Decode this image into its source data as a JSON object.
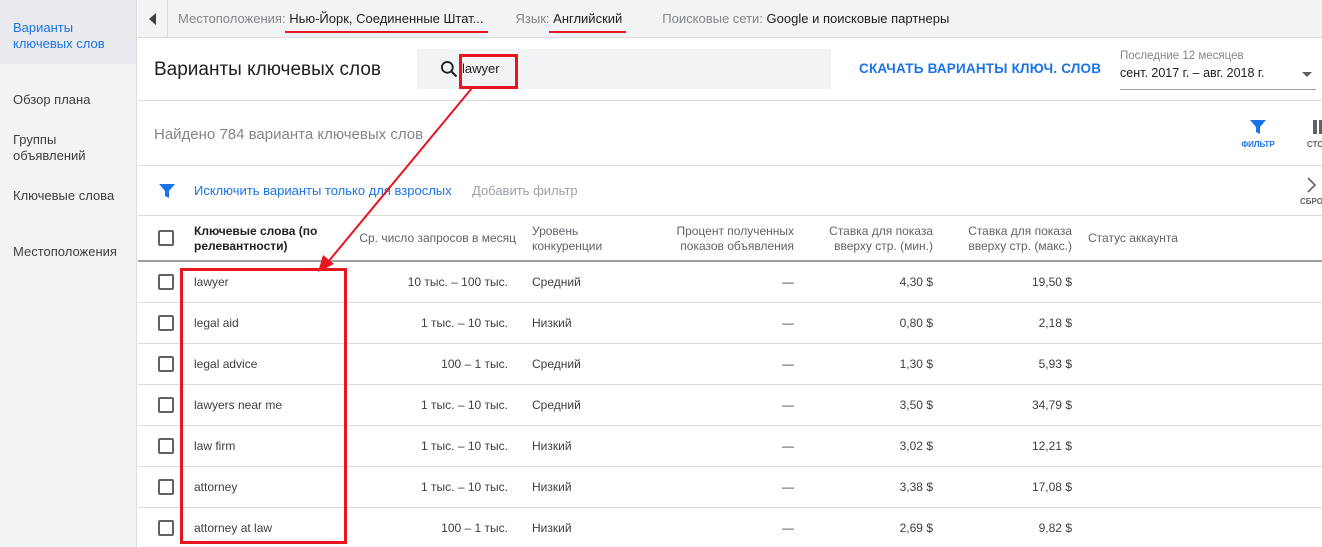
{
  "sidebar": {
    "items": [
      {
        "label": "Варианты ключевых слов",
        "active": true
      },
      {
        "label": "Обзор плана"
      },
      {
        "label": "Группы объявлений"
      },
      {
        "label": "Ключевые слова"
      },
      {
        "label": "Местоположения"
      }
    ]
  },
  "topbar": {
    "location_label": "Местоположения:",
    "location_value": "Нью-Йорк, Соединенные Штат...",
    "language_label": "Язык:",
    "language_value": "Английский",
    "networks_label": "Поисковые сети:",
    "networks_value": "Google и поисковые партнеры"
  },
  "header": {
    "title": "Варианты ключевых слов",
    "search_value": "lawyer",
    "download_label": "СКАЧАТЬ ВАРИАНТЫ КЛЮЧ. СЛОВ",
    "date_label": "Последние 12 месяцев",
    "date_value": "сент. 2017 г. – авг. 2018 г."
  },
  "found": {
    "text": "Найдено 784 варианта ключевых слов",
    "filter_label": "ФИЛЬТР",
    "columns_label": "СТОЛ"
  },
  "filters": {
    "exclude_label": "Исключить варианты только для взрослых",
    "add_filter_label": "Добавить фильтр",
    "reset_label": "СБРО"
  },
  "table": {
    "headers": {
      "keyword": "Ключевые слова (по релевантности)",
      "avg": "Ср. число запросов в месяц",
      "competition": "Уровень конкуренции",
      "share": "Процент полученных показов объявления",
      "bid_low": "Ставка для показа вверху стр. (мин.)",
      "bid_high": "Ставка для показа вверху стр. (макс.)",
      "status": "Статус аккаунта"
    },
    "rows": [
      {
        "keyword": "lawyer",
        "avg": "10 тыс. – 100 тыс.",
        "competition": "Средний",
        "share": "—",
        "bid_low": "4,30 $",
        "bid_high": "19,50 $"
      },
      {
        "keyword": "legal aid",
        "avg": "1 тыс. – 10 тыс.",
        "competition": "Низкий",
        "share": "—",
        "bid_low": "0,80 $",
        "bid_high": "2,18 $"
      },
      {
        "keyword": "legal advice",
        "avg": "100 – 1 тыс.",
        "competition": "Средний",
        "share": "—",
        "bid_low": "1,30 $",
        "bid_high": "5,93 $"
      },
      {
        "keyword": "lawyers near me",
        "avg": "1 тыс. – 10 тыс.",
        "competition": "Средний",
        "share": "—",
        "bid_low": "3,50 $",
        "bid_high": "34,79 $"
      },
      {
        "keyword": "law firm",
        "avg": "1 тыс. – 10 тыс.",
        "competition": "Низкий",
        "share": "—",
        "bid_low": "3,02 $",
        "bid_high": "12,21 $"
      },
      {
        "keyword": "attorney",
        "avg": "1 тыс. – 10 тыс.",
        "competition": "Низкий",
        "share": "—",
        "bid_low": "3,38 $",
        "bid_high": "17,08 $"
      },
      {
        "keyword": "attorney at law",
        "avg": "100 – 1 тыс.",
        "competition": "Низкий",
        "share": "—",
        "bid_low": "2,69 $",
        "bid_high": "9,82 $"
      }
    ]
  },
  "colors": {
    "accent": "#1a73e8",
    "annotation": "#e8141f"
  }
}
